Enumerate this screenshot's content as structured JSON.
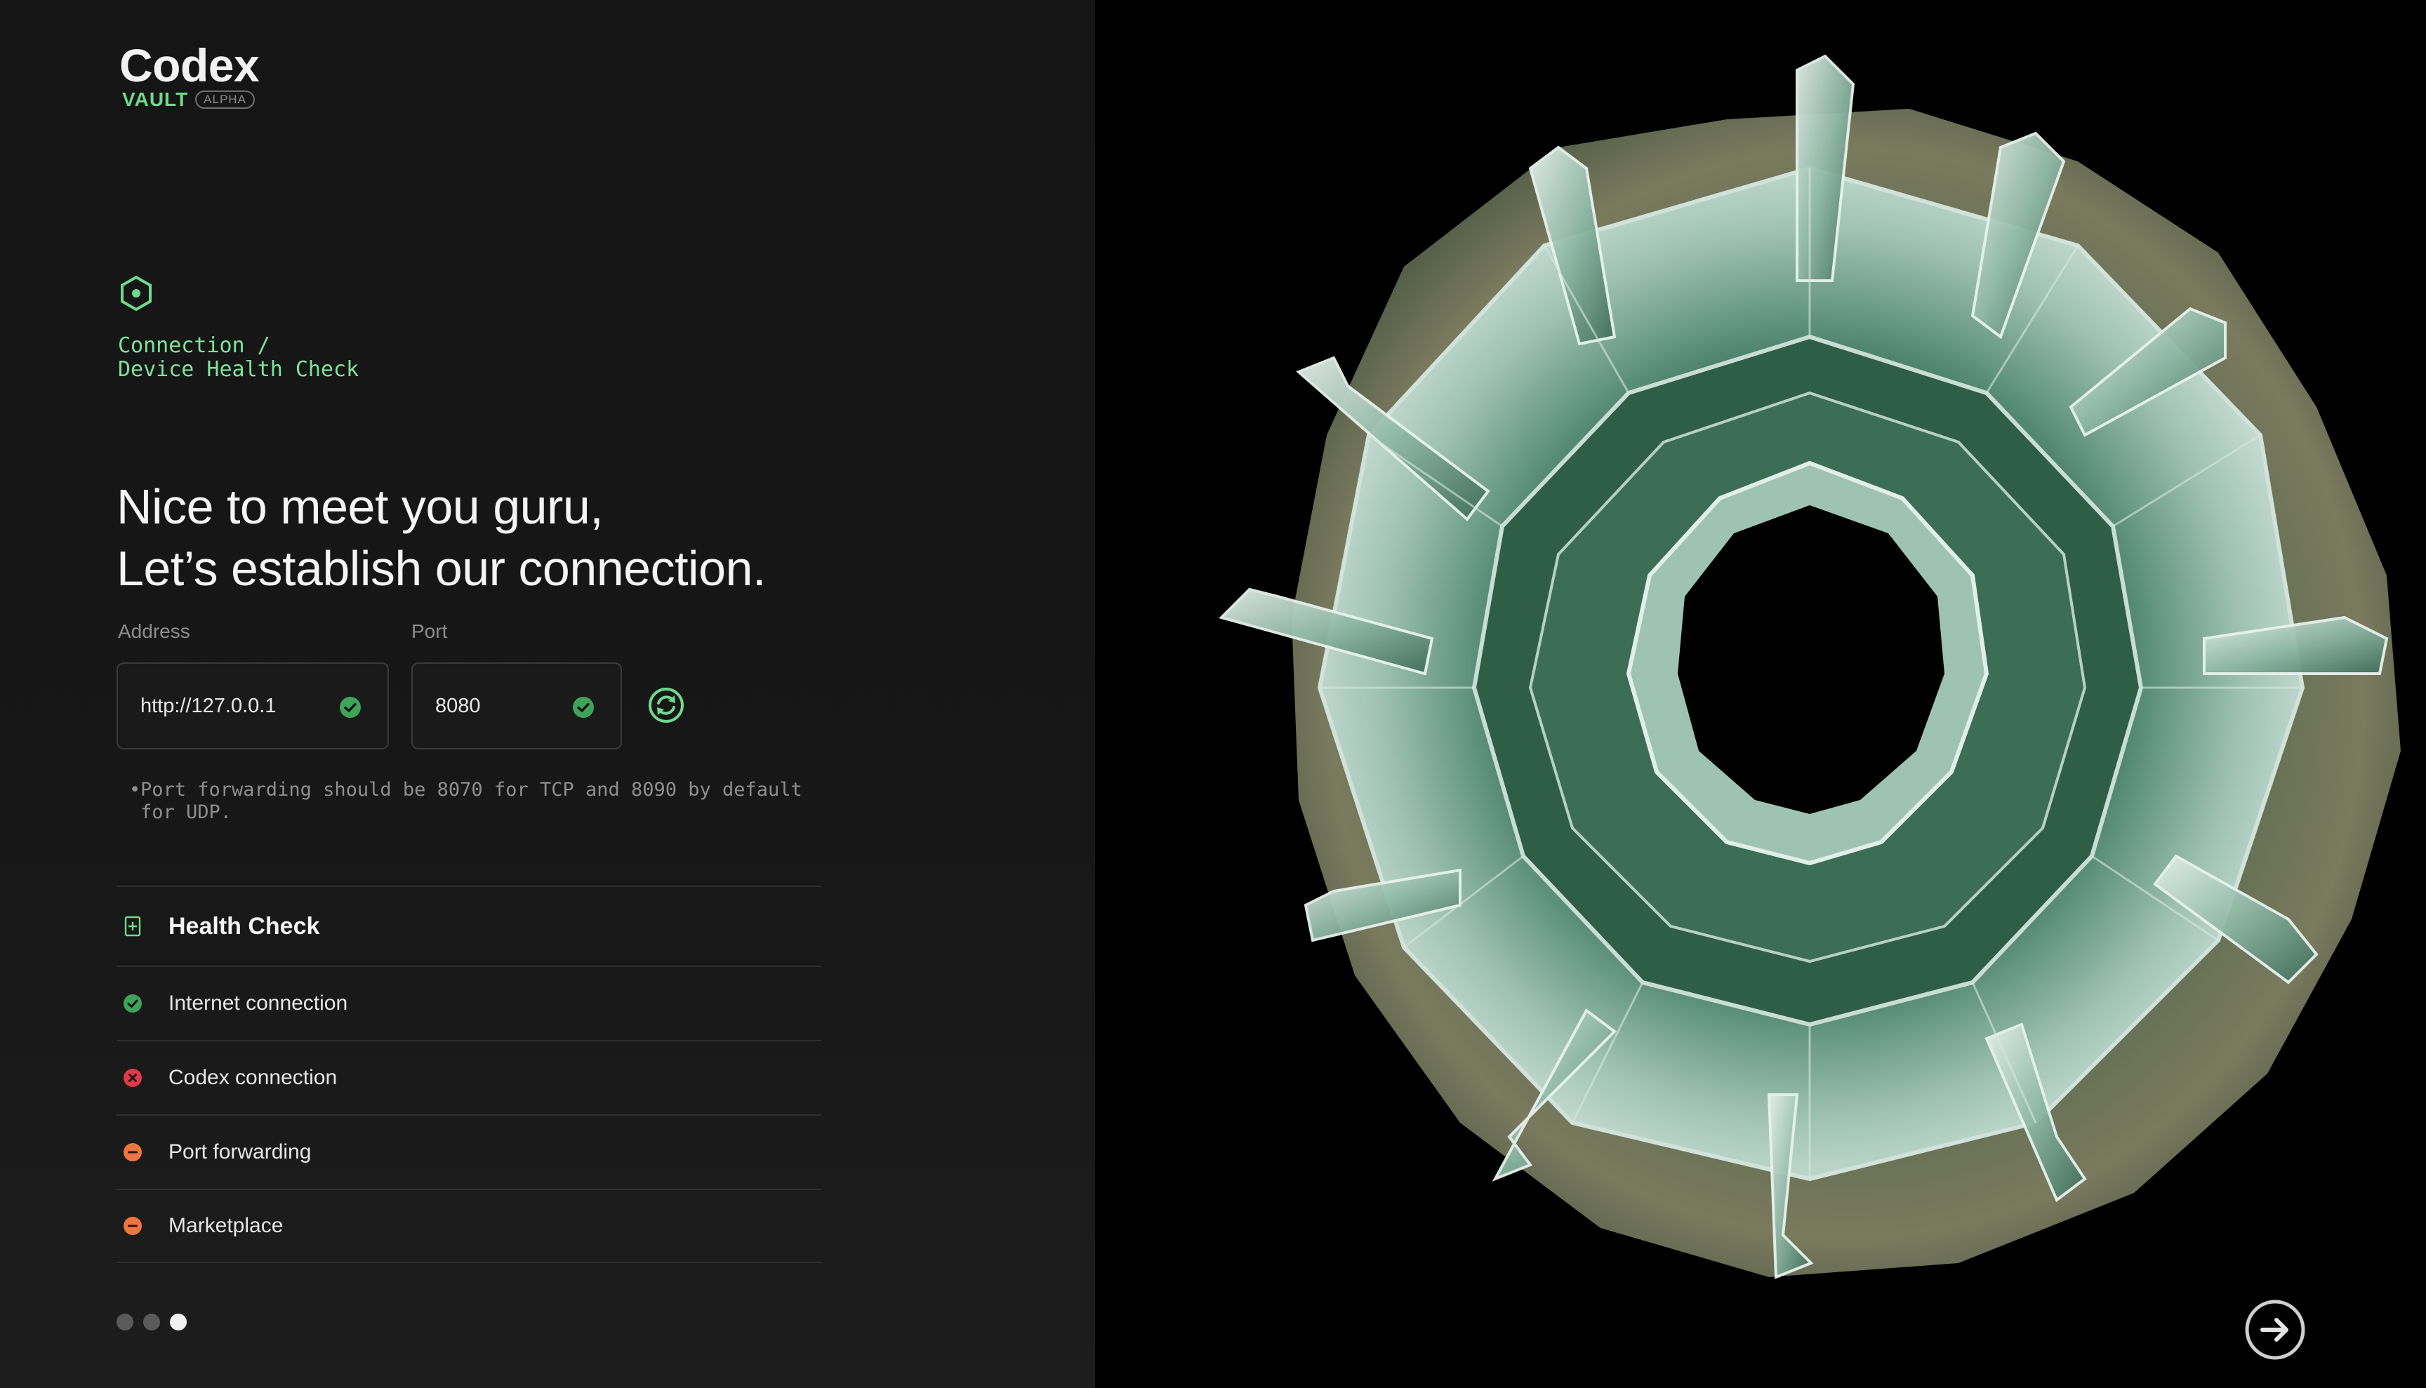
{
  "brand": {
    "title": "Codex",
    "vault": "VAULT",
    "badge": "ALPHA"
  },
  "breadcrumb": {
    "line1": "Connection /",
    "line2": "Device Health Check"
  },
  "headline": {
    "line1": "Nice to meet you guru,",
    "line2": "Let’s establish our connection."
  },
  "form": {
    "address_label": "Address",
    "address_value": "http://127.0.0.1",
    "port_label": "Port",
    "port_value": "8080",
    "note": "Port forwarding should be 8070 for TCP and 8090 by default for UDP."
  },
  "health": {
    "title": "Health Check",
    "items": [
      {
        "label": "Internet connection",
        "status": "ok"
      },
      {
        "label": "Codex connection",
        "status": "error"
      },
      {
        "label": "Port forwarding",
        "status": "warning"
      },
      {
        "label": "Marketplace",
        "status": "warning"
      }
    ]
  },
  "colors": {
    "accent": "#6fd98c",
    "ok": "#3ea45a",
    "error": "#e0394a",
    "warning": "#ee7440"
  },
  "icons": {
    "step": "hexagon-dot-icon",
    "refresh": "refresh-icon",
    "health": "health-plus-icon",
    "next": "arrow-right-circle-icon"
  },
  "pagination": {
    "total": 3,
    "active": 3
  }
}
